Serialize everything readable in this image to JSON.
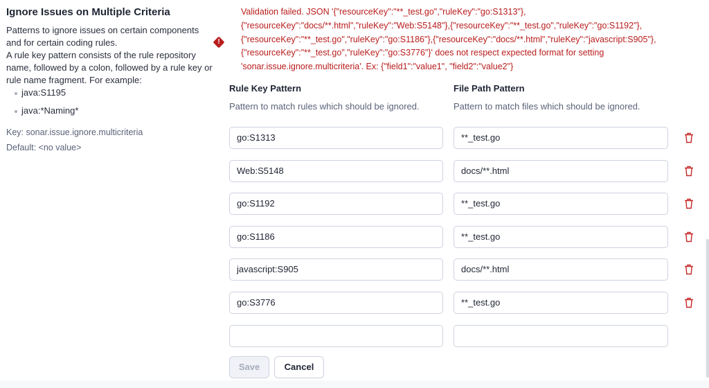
{
  "setting": {
    "title": "Ignore Issues on Multiple Criteria",
    "description_lines": [
      "Patterns to ignore issues on certain components and for certain coding rules.",
      "A rule key pattern consists of the rule repository name, followed by a colon, followed by a rule key or rule name fragment. For example:"
    ],
    "examples": [
      "java:S1195",
      "java:*Naming*"
    ],
    "key": "Key: sonar.issue.ignore.multicriteria",
    "default": "Default: <no value>"
  },
  "error": {
    "icon": "error-diamond-icon",
    "color": "#b91c1c",
    "lines": [
      "Validation failed. JSON '{\"resourceKey\":\"**_test.go\",\"ruleKey\":\"go:S1313\"},",
      "{\"resourceKey\":\"docs/**.html\",\"ruleKey\":\"Web:S5148\"},{\"resourceKey\":\"**_test.go\",\"ruleKey\":\"go:S1192\"},",
      "{\"resourceKey\":\"**_test.go\",\"ruleKey\":\"go:S1186\"},{\"resourceKey\":\"docs/**.html\",\"ruleKey\":\"javascript:S905\"},",
      "{\"resourceKey\":\"**_test.go\",\"ruleKey\":\"go:S3776\"}' does not respect expected format for setting",
      "'sonar.issue.ignore.multicriteria'. Ex: {\"field1\":\"value1\", \"field2\":\"value2\"}"
    ]
  },
  "columns": [
    {
      "title": "Rule Key Pattern",
      "subtitle": "Pattern to match rules which should be ignored."
    },
    {
      "title": "File Path Pattern",
      "subtitle": "Pattern to match files which should be ignored."
    }
  ],
  "rows": [
    {
      "rule": "go:S1313",
      "path": "**_test.go"
    },
    {
      "rule": "Web:S5148",
      "path": "docs/**.html"
    },
    {
      "rule": "go:S1192",
      "path": "**_test.go"
    },
    {
      "rule": "go:S1186",
      "path": "**_test.go"
    },
    {
      "rule": "javascript:S905",
      "path": "docs/**.html"
    },
    {
      "rule": "go:S3776",
      "path": "**_test.go"
    },
    {
      "rule": "",
      "path": ""
    }
  ],
  "buttons": {
    "save": "Save",
    "cancel": "Cancel"
  }
}
